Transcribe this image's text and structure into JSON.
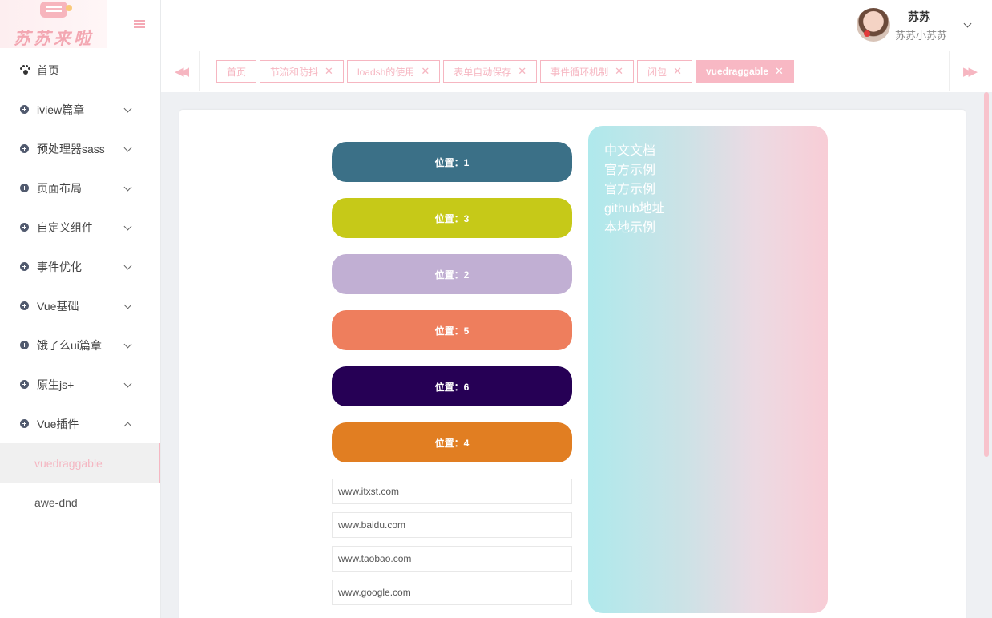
{
  "sidebar": {
    "logo_text": "苏苏来啦",
    "items": [
      {
        "label": "首页"
      },
      {
        "label": "iview篇章"
      },
      {
        "label": "预处理器sass"
      },
      {
        "label": "页面布局"
      },
      {
        "label": "自定义组件"
      },
      {
        "label": "事件优化"
      },
      {
        "label": "Vue基础"
      },
      {
        "label": "饿了么ui篇章"
      },
      {
        "label": "原生js+"
      },
      {
        "label": "Vue插件"
      }
    ],
    "submenu": [
      {
        "label": "vuedraggable",
        "active": true
      },
      {
        "label": "awe-dnd",
        "active": false
      }
    ]
  },
  "header": {
    "user_name": "苏苏",
    "user_sub": "苏苏小苏苏"
  },
  "tabs": [
    {
      "label": "首页",
      "closable": false
    },
    {
      "label": "节流和防抖",
      "closable": true
    },
    {
      "label": "loadsh的使用",
      "closable": true
    },
    {
      "label": "表单自动保存",
      "closable": true
    },
    {
      "label": "事件循环机制",
      "closable": true
    },
    {
      "label": "闭包",
      "closable": true
    },
    {
      "label": "vuedraggable",
      "closable": true,
      "active": true
    }
  ],
  "draggable_items": [
    {
      "label": "位置：1",
      "color": "#3b7087"
    },
    {
      "label": "位置：3",
      "color": "#c6c918"
    },
    {
      "label": "位置：2",
      "color": "#c1afd3"
    },
    {
      "label": "位置：5",
      "color": "#ee7e5d"
    },
    {
      "label": "位置：6",
      "color": "#260055"
    },
    {
      "label": "位置：4",
      "color": "#e17e22"
    }
  ],
  "sites": [
    "www.itxst.com",
    "www.baidu.com",
    "www.taobao.com",
    "www.google.com"
  ],
  "links": [
    "中文文档",
    "官方示例",
    "官方示例",
    "github地址",
    "本地示例"
  ],
  "colors": {
    "accent": "#f6b6c1"
  }
}
